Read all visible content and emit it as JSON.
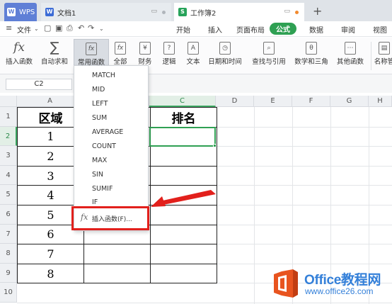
{
  "tabs": {
    "wps": "WPS",
    "doc": "文档1",
    "book": "工作簿2"
  },
  "menubar": {
    "file": "文件",
    "items": [
      "开始",
      "插入",
      "页面布局",
      "公式",
      "数据",
      "审阅",
      "视图"
    ],
    "active": "公式"
  },
  "ribbon": {
    "insert_function": "插入函数",
    "autosum": "自动求和",
    "common_functions": "常用函数",
    "all": "全部",
    "finance": "财务",
    "logic": "逻辑",
    "text": "文本",
    "datetime": "日期和时间",
    "lookup": "查找与引用",
    "math": "数学和三角",
    "other": "其他函数",
    "name_manager": "名称管"
  },
  "formula_bar": {
    "cell_ref": "C2"
  },
  "grid": {
    "columns": [
      "A",
      "B",
      "C",
      "D",
      "E",
      "F",
      "G",
      "H"
    ],
    "rows": [
      "1",
      "2",
      "3",
      "4",
      "5",
      "6",
      "7",
      "8",
      "9",
      "10"
    ],
    "header_a": "区域",
    "header_c": "排名",
    "values_a": [
      "1",
      "2",
      "3",
      "4",
      "5",
      "6",
      "7",
      "8"
    ]
  },
  "dropdown": {
    "items": [
      "MATCH",
      "MID",
      "LEFT",
      "SUM",
      "AVERAGE",
      "COUNT",
      "MAX",
      "SIN",
      "SUMIF",
      "IF"
    ],
    "insert_label": "插入函数(F)..."
  },
  "watermark": {
    "title": "Office教程网",
    "url": "www.office26.com"
  },
  "colors": {
    "accent": "#2fa053",
    "annotation": "#e2201c",
    "watermark": "#3480d9"
  }
}
